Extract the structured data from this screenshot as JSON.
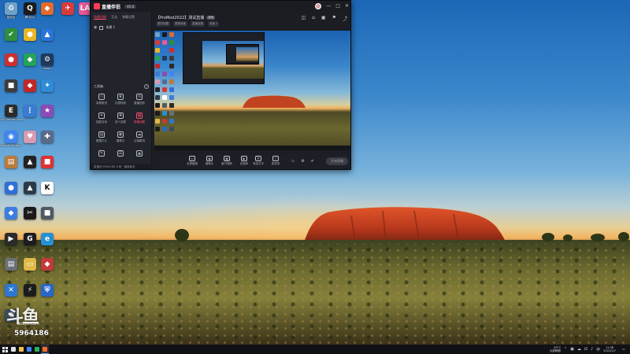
{
  "desktop": {
    "icons": [
      {
        "name": "icon-recycle-bin",
        "label": "回收站",
        "color": "#6fa0c8",
        "glyph": "♻"
      },
      {
        "name": "icon-qq",
        "label": "腾讯QQ",
        "color": "#1b1b1b",
        "glyph": "Q"
      },
      {
        "name": "icon-app-orange",
        "label": "",
        "color": "#e36b2c",
        "glyph": "◆"
      },
      {
        "name": "icon-app-red",
        "label": "",
        "color": "#d53b3b",
        "glyph": "✈"
      },
      {
        "name": "icon-app-pink",
        "label": "",
        "color": "#e95a9a",
        "glyph": "LA"
      },
      {
        "name": "icon-shield-security",
        "label": "",
        "color": "#2d8f3c",
        "glyph": "✔"
      },
      {
        "name": "icon-app-yellow",
        "label": "",
        "color": "#e9b623",
        "glyph": "●"
      },
      {
        "name": "icon-app-blue-arrow",
        "label": "",
        "color": "#2a74d6",
        "glyph": "▲"
      },
      {
        "name": "icon-app-red-circle",
        "label": "",
        "color": "#cf2f2f",
        "glyph": "●"
      },
      {
        "name": "icon-app-green",
        "label": "",
        "color": "#25a35a",
        "glyph": "◆"
      },
      {
        "name": "icon-steam",
        "label": "Steam",
        "color": "#1e3a5c",
        "glyph": "⚙"
      },
      {
        "name": "icon-app-dark",
        "label": "",
        "color": "#3c3c3c",
        "glyph": "■"
      },
      {
        "name": "icon-app-red-game",
        "label": "",
        "color": "#c12828",
        "glyph": "◆"
      },
      {
        "name": "icon-app-multicolor",
        "label": "",
        "color": "#2f8bd8",
        "glyph": "✦"
      },
      {
        "name": "icon-epic-games",
        "label": "Epic Games Launcher",
        "color": "#2b2b2b",
        "glyph": "E"
      },
      {
        "name": "icon-app-dots",
        "label": "",
        "color": "#3b7bd1",
        "glyph": "⋮"
      },
      {
        "name": "icon-app-game-art",
        "label": "",
        "color": "#8a4bb8",
        "glyph": "★"
      },
      {
        "name": "icon-chrome",
        "label": "Google Chrome",
        "color": "#4285f4",
        "glyph": "◉"
      },
      {
        "name": "icon-app-anime",
        "label": "",
        "color": "#d99ab2",
        "glyph": "♥"
      },
      {
        "name": "icon-app-gamepad",
        "label": "",
        "color": "#5a6b8a",
        "glyph": "✚"
      },
      {
        "name": "icon-app-shelf",
        "label": "",
        "color": "#b97b3b",
        "glyph": "▤"
      },
      {
        "name": "icon-app-dark-game",
        "label": "",
        "color": "#222",
        "glyph": "▲"
      },
      {
        "name": "icon-app-red-square",
        "label": "",
        "color": "#d33",
        "glyph": "■"
      },
      {
        "name": "icon-app-blue-planet",
        "label": "",
        "color": "#2f6fd6",
        "glyph": "●"
      },
      {
        "name": "icon-app-wolf",
        "label": "",
        "color": "#2a3a4a",
        "glyph": "▲"
      },
      {
        "name": "icon-app-k",
        "label": "",
        "color": "#ffffff",
        "glyph": "K"
      },
      {
        "name": "icon-app-blue-cube",
        "label": "",
        "color": "#3d7de0",
        "glyph": "◆"
      },
      {
        "name": "icon-capcut",
        "label": "",
        "color": "#1a1a1a",
        "glyph": "✂"
      },
      {
        "name": "icon-app-gray",
        "label": "",
        "color": "#505a64",
        "glyph": "■"
      },
      {
        "name": "icon-nvidia",
        "label": "",
        "color": "#2b2b2b",
        "glyph": "▶"
      },
      {
        "name": "icon-logitech",
        "label": "",
        "color": "#1c1c1c",
        "glyph": "G"
      },
      {
        "name": "icon-edge",
        "label": "",
        "color": "#2790d0",
        "glyph": "e"
      },
      {
        "name": "icon-app-gray-doc",
        "label": "",
        "color": "#6b6f76",
        "glyph": "▤"
      },
      {
        "name": "icon-app-folder",
        "label": "",
        "color": "#e0b94a",
        "glyph": "▭"
      },
      {
        "name": "icon-app-racing",
        "label": "",
        "color": "#c23a3a",
        "glyph": "◆"
      },
      {
        "name": "icon-app-blue-bird",
        "label": "",
        "color": "#2e77d0",
        "glyph": "✕"
      },
      {
        "name": "icon-amd",
        "label": "",
        "color": "#1c1c1c",
        "glyph": "⚡"
      },
      {
        "name": "icon-app-shield-blue",
        "label": "",
        "color": "#2a66c8",
        "glyph": "⛨"
      },
      {
        "name": "icon-app-fan",
        "label": "",
        "color": "#3c4c5c",
        "glyph": "✺"
      }
    ]
  },
  "watermark": {
    "logo": "斗鱼",
    "sub": "douyu.com",
    "room_number": "5964186"
  },
  "app": {
    "name": "直播伴侣",
    "version": "V5.6",
    "window_controls": [
      "—",
      "□",
      "✕"
    ],
    "left_tabs": [
      "场景切换",
      "互动",
      "弹幕设置"
    ],
    "scene_label": "场景 1",
    "tools_title": "工具箱",
    "tools_help": "?",
    "tools": [
      {
        "name": "tool-screen-record",
        "label": "录屏推流",
        "glyph": "▭",
        "hot": false
      },
      {
        "name": "tool-gift",
        "label": "礼物特效",
        "glyph": "♛",
        "hot": false
      },
      {
        "name": "tool-replay",
        "label": "直播回放",
        "glyph": "⟲",
        "hot": false
      },
      {
        "name": "tool-lottery",
        "label": "抽奖互动",
        "glyph": "✦",
        "hot": false
      },
      {
        "name": "tool-guest",
        "label": "多人连麦",
        "glyph": "✚",
        "hot": false
      },
      {
        "name": "tool-topic",
        "label": "直播话题",
        "glyph": "▦",
        "hot": true
      },
      {
        "name": "tool-data",
        "label": "数据中心",
        "glyph": "▤",
        "hot": false
      },
      {
        "name": "tool-camera",
        "label": "摄像头",
        "glyph": "◉",
        "hot": false
      },
      {
        "name": "tool-cloud",
        "label": "云端推流",
        "glyph": "☁",
        "hot": false
      },
      {
        "name": "tool-more-1",
        "label": "",
        "glyph": "✎",
        "hot": false
      },
      {
        "name": "tool-more-2",
        "label": "",
        "glyph": "☰",
        "hot": false
      },
      {
        "name": "tool-more-3",
        "label": "",
        "glyph": "▲",
        "hot": false
      }
    ],
    "left_footer": "直播间 5964186  斗鱼 · 最新版本",
    "room_title": "【ProMod2022】测试直播",
    "room_badge": "游戏",
    "room_tags": [
      "更改标题",
      "更换封面",
      "直播设置",
      "热度 1"
    ],
    "top_icons": [
      "◫",
      "⌂",
      "▣",
      "⚑",
      "⤴"
    ],
    "bottom_tools": [
      {
        "name": "bottom-tool-desktop",
        "label": "全屏截图",
        "glyph": "▭"
      },
      {
        "name": "bottom-tool-camera",
        "label": "摄像头",
        "glyph": "◉"
      },
      {
        "name": "bottom-tool-window",
        "label": "窗口捕获",
        "glyph": "▦"
      },
      {
        "name": "bottom-tool-image",
        "label": "多媒体",
        "glyph": "▶"
      },
      {
        "name": "bottom-tool-text",
        "label": "添加文字",
        "glyph": "A"
      },
      {
        "name": "bottom-tool-audio",
        "label": "麦克风",
        "glyph": "♪"
      }
    ],
    "bottom_right_icons": [
      "▭",
      "⚙",
      "✔"
    ],
    "start_live_label": "开始直播"
  },
  "taskbar": {
    "apps": [
      {
        "name": "taskbar-search",
        "color": "#dfe3ea"
      },
      {
        "name": "taskbar-file-explorer",
        "color": "#f2c04a"
      },
      {
        "name": "taskbar-chrome",
        "color": "#4285f4"
      },
      {
        "name": "taskbar-app-green",
        "color": "#29b35a"
      },
      {
        "name": "taskbar-live-app",
        "color": "#ff6a2a"
      }
    ],
    "weather_temp": "40°C",
    "weather_text": "大部晴朗",
    "tray_icons": [
      "⌃",
      "▣",
      "☁",
      "⊡",
      "♪",
      "中"
    ],
    "time": "11:56",
    "date": "2022/2/7"
  }
}
